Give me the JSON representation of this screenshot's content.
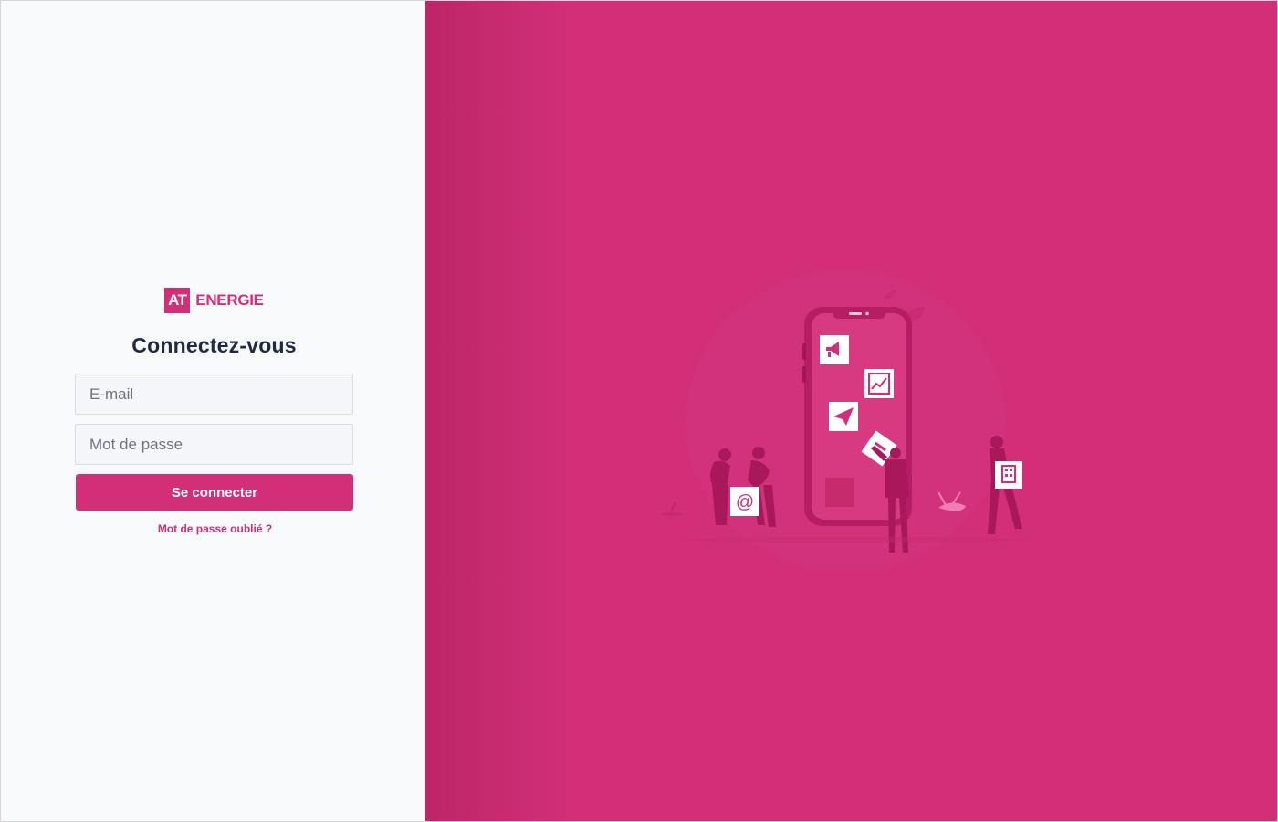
{
  "brand": {
    "logo_box": "AT",
    "logo_text": "ENERGIE",
    "color": "#d22f78"
  },
  "login": {
    "title": "Connectez-vous",
    "email_placeholder": "E-mail",
    "password_placeholder": "Mot de passe",
    "submit_label": "Se connecter",
    "forgot_link": "Mot de passe oublié ?"
  },
  "illustration": {
    "icons": [
      "megaphone-icon",
      "chart-icon",
      "paper-plane-icon",
      "at-sign-icon",
      "building-icon",
      "document-icon"
    ]
  }
}
